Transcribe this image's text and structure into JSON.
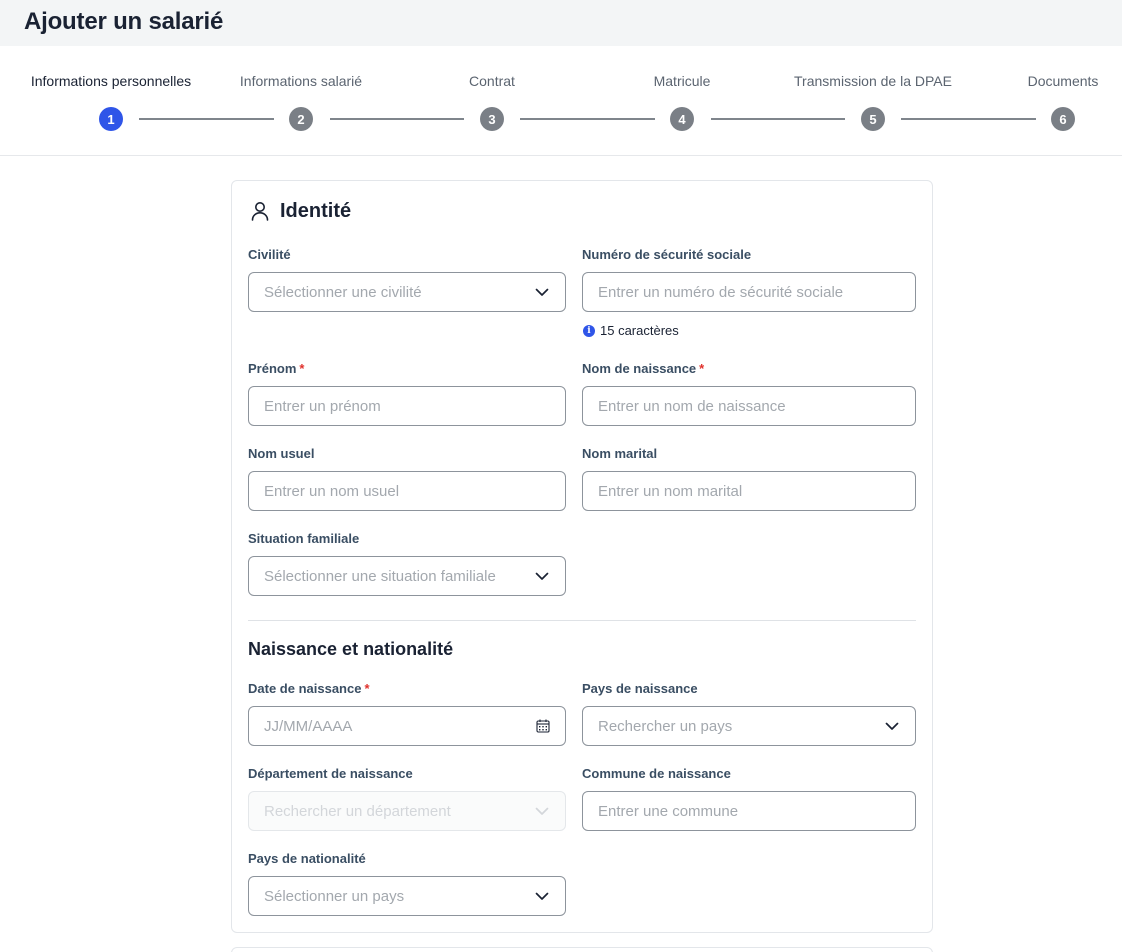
{
  "page": {
    "title": "Ajouter un salarié"
  },
  "stepper": {
    "steps": [
      {
        "label": "Informations personnelles",
        "number": "1",
        "active": true
      },
      {
        "label": "Informations salarié",
        "number": "2",
        "active": false
      },
      {
        "label": "Contrat",
        "number": "3",
        "active": false
      },
      {
        "label": "Matricule",
        "number": "4",
        "active": false
      },
      {
        "label": "Transmission de la DPAE",
        "number": "5",
        "active": false
      },
      {
        "label": "Documents",
        "number": "6",
        "active": false
      }
    ]
  },
  "identity": {
    "title": "Identité",
    "civilite": {
      "label": "Civilité",
      "placeholder": "Sélectionner une civilité"
    },
    "nss": {
      "label": "Numéro de sécurité sociale",
      "placeholder": "Entrer un numéro de sécurité sociale",
      "hint": "15 caractères"
    },
    "prenom": {
      "label": "Prénom",
      "required": "*",
      "placeholder": "Entrer un prénom"
    },
    "nom_naissance": {
      "label": "Nom de naissance",
      "required": "*",
      "placeholder": "Entrer un nom de naissance"
    },
    "nom_usuel": {
      "label": "Nom usuel",
      "placeholder": "Entrer un nom usuel"
    },
    "nom_marital": {
      "label": "Nom marital",
      "placeholder": "Entrer un nom marital"
    },
    "situation": {
      "label": "Situation familiale",
      "placeholder": "Sélectionner une situation familiale"
    }
  },
  "birth": {
    "title": "Naissance et nationalité",
    "date": {
      "label": "Date de naissance",
      "required": "*",
      "placeholder": "JJ/MM/AAAA"
    },
    "pays_naissance": {
      "label": "Pays de naissance",
      "placeholder": "Rechercher un pays"
    },
    "departement": {
      "label": "Département de naissance",
      "placeholder": "Rechercher un département",
      "disabled": true
    },
    "commune": {
      "label": "Commune de naissance",
      "placeholder": "Entrer une commune"
    },
    "nationalite": {
      "label": "Pays de nationalité",
      "placeholder": "Sélectionner un pays"
    }
  },
  "colors": {
    "accent": "#2f55e8",
    "step_inactive": "#7a7f86",
    "label": "#3a4e63",
    "required": "#e0312c"
  },
  "icons": [
    "person-icon",
    "chevron-down-icon",
    "calendar-icon",
    "info-icon"
  ]
}
